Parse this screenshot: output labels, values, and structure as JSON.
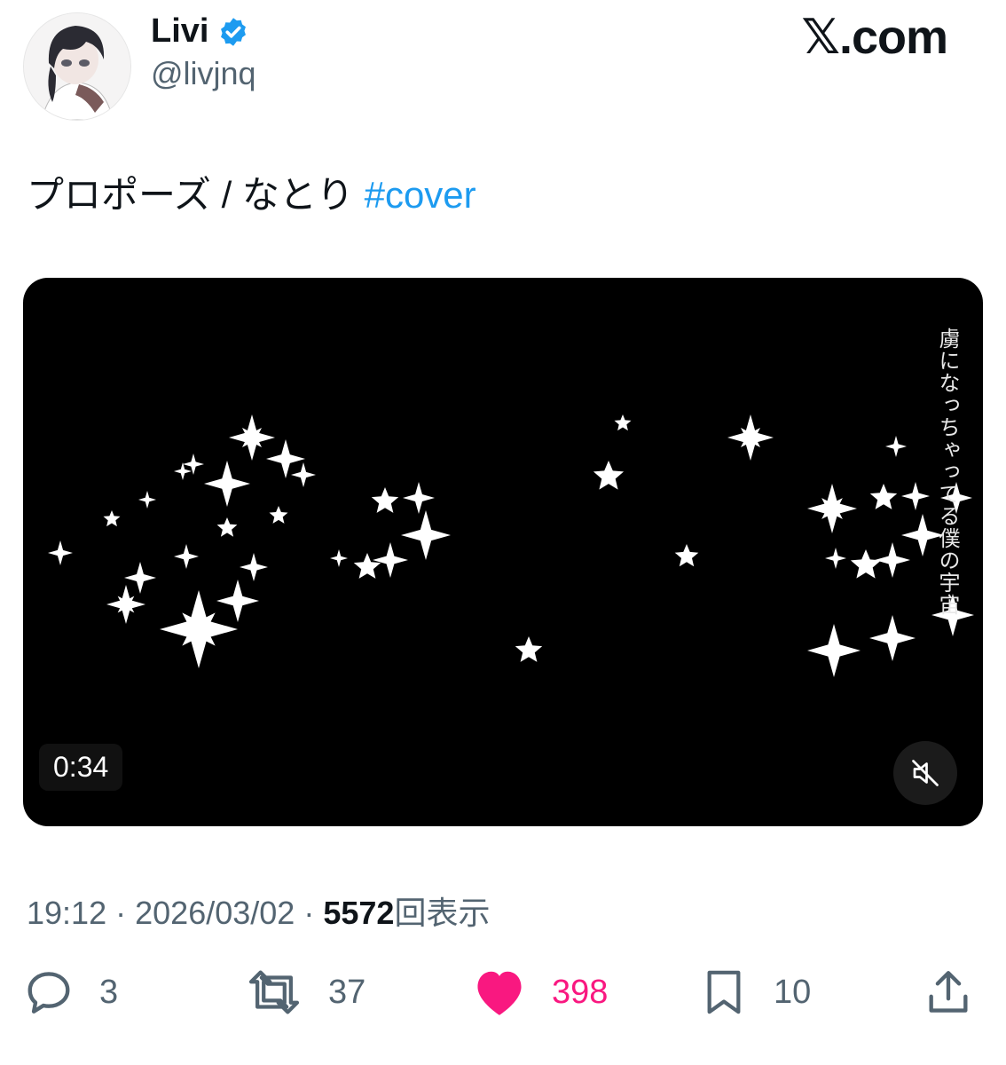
{
  "author": {
    "display_name": "Livi",
    "handle": "@livjnq",
    "verified": true,
    "avatar_icon": "anime-avatar"
  },
  "brand": {
    "label": "𝕏.com",
    "icon": "x-logo"
  },
  "tweet": {
    "text": "プロポーズ / なとり",
    "hashtag": "#cover"
  },
  "media": {
    "duration": "0:34",
    "lyric_overlay": "虜になっちゃってる僕の宇宙",
    "mute_icon": "speaker-muted-icon",
    "background": "#000000"
  },
  "meta": {
    "time": "19:12",
    "separator": "·",
    "date": "2026/03/02",
    "views_count": "5572",
    "views_label": "回表示"
  },
  "actions": {
    "replies": "3",
    "retweets": "37",
    "likes": "398",
    "bookmarks": "10"
  },
  "colors": {
    "link": "#1d9bf0",
    "like": "#f91880",
    "secondary_text": "#536471",
    "primary_text": "#0f1419",
    "verified": "#1d9bf0"
  }
}
